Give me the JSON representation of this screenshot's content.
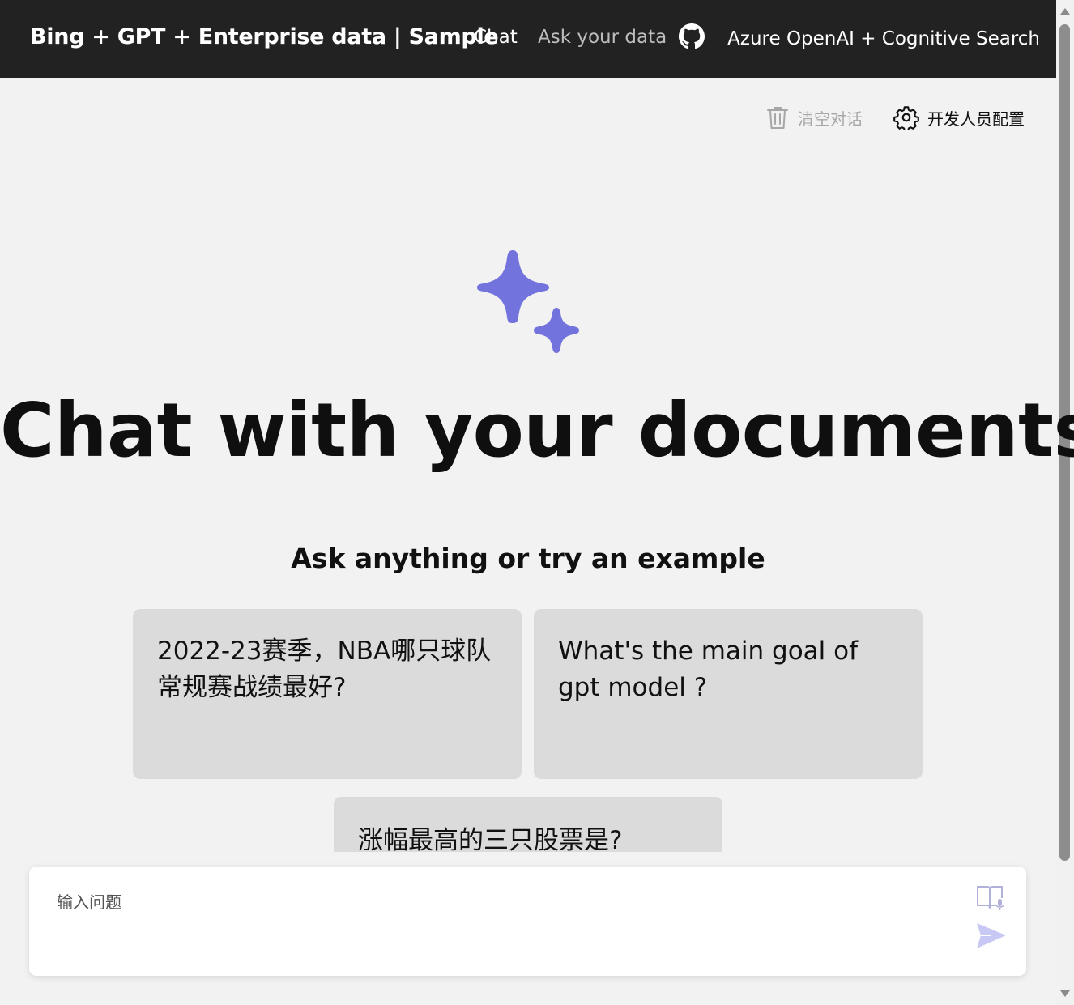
{
  "header": {
    "brand": "Bing + GPT + Enterprise data | Sample",
    "nav": [
      {
        "label": "Chat",
        "active": true
      },
      {
        "label": "Ask your data",
        "active": false
      }
    ],
    "github_icon": "github-icon",
    "right_title": "Azure OpenAI + Cognitive Search"
  },
  "commands": {
    "clear_label": "清空对话",
    "clear_icon": "trash-icon",
    "dev_label": "开发人员配置",
    "dev_icon": "gear-icon"
  },
  "hero": {
    "icon": "sparkle-icon",
    "icon_color": "#7373de",
    "title": "Chat with your documents",
    "subtitle": "Ask anything or try an example"
  },
  "examples": [
    {
      "text": "2022-23赛季，NBA哪只球队常规赛战绩最好?"
    },
    {
      "text": "What's the main goal of gpt model ?"
    },
    {
      "text": "涨幅最高的三只股票是?"
    }
  ],
  "input": {
    "placeholder": "输入问题",
    "value": "",
    "mic_icon": "book-mic-icon",
    "send_icon": "send-icon",
    "accent": "#c8c8f4"
  },
  "colors": {
    "header_bg": "#222222",
    "page_bg": "#f2f2f2",
    "card_bg": "#dbdbdb"
  }
}
